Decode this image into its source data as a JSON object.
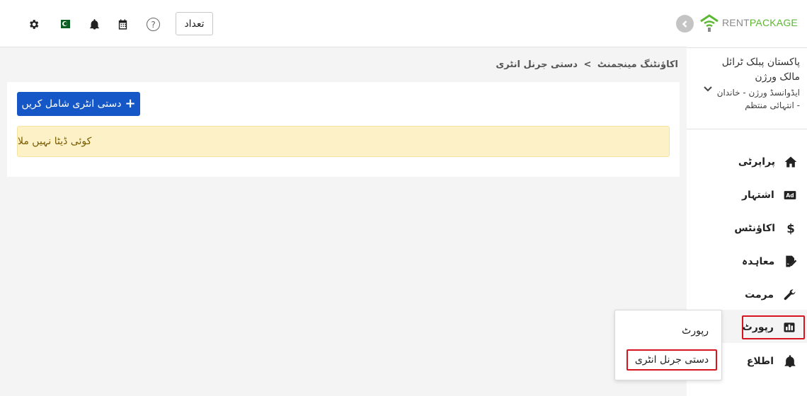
{
  "header": {
    "count_button_label": "تعداد",
    "help_glyph": "?",
    "icons": [
      "settings-icon",
      "pakistan-flag-icon",
      "bell-icon",
      "calendar-icon",
      "help-icon"
    ]
  },
  "breadcrumb": {
    "parent": "اکاؤنٹنگ مینجمنٹ",
    "separator": ">",
    "current": "دستی جرنل انٹری"
  },
  "main": {
    "add_button_label": "دستی انٹری شامل کریں",
    "add_button_icon": "+",
    "empty_message": "کوئی ڈیٹا نہیں ملا"
  },
  "sidebar": {
    "logo": {
      "rent": "RENT",
      "package": "PACKAGE"
    },
    "company": {
      "name": "پاکستان پبلک ٹرائل مالک ورژن",
      "plan": "ایڈوانسڈ ورژن - خاندان - انتہائی منتظم"
    },
    "items": [
      {
        "label": "پراپرٹی",
        "icon": "home-icon"
      },
      {
        "label": "اشتہار",
        "icon": "ad-icon"
      },
      {
        "label": "اکاؤنٹس",
        "icon": "dollar-icon"
      },
      {
        "label": "معاہدہ",
        "icon": "contract-icon"
      },
      {
        "label": "مرمت",
        "icon": "wrench-icon"
      },
      {
        "label": "رپورٹ",
        "icon": "chart-icon"
      },
      {
        "label": "اطلاع",
        "icon": "bell-icon"
      }
    ]
  },
  "popup": {
    "items": [
      {
        "label": "رپورٹ"
      },
      {
        "label": "دستی جرنل انٹری"
      }
    ]
  },
  "colors": {
    "primary": "#1557c6",
    "highlight_border": "#d8141e",
    "brand_green": "#5cb832",
    "alert_bg": "#fdf2c7"
  }
}
